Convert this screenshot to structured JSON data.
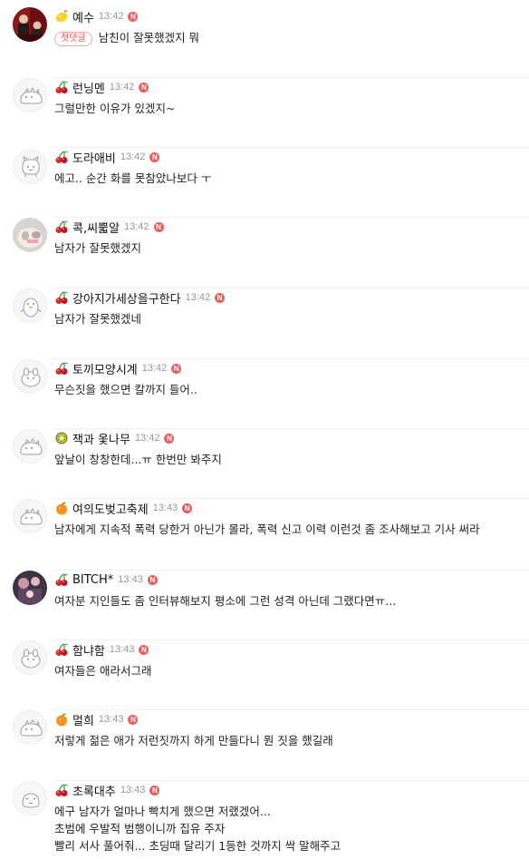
{
  "comments": [
    {
      "nick": "예수",
      "time": "13:42",
      "badge": "N",
      "emoji": "lemon-icon",
      "avatar": "photo",
      "first_badge": "첫댓글",
      "lines": [
        "남친이 잘못했겠지 뭐"
      ]
    },
    {
      "nick": "런닝멘",
      "time": "13:42",
      "badge": "N",
      "emoji": "cherry-icon",
      "avatar": "default",
      "lines": [
        "그럴만한 이유가 있겠지~"
      ]
    },
    {
      "nick": "도라애비",
      "time": "13:42",
      "badge": "N",
      "emoji": "cherry-icon",
      "avatar": "default",
      "lines": [
        "에고.. 순간 화를 못참았나보다 ㅜ"
      ]
    },
    {
      "nick": "콕,씨뿗알",
      "time": "13:42",
      "badge": "N",
      "emoji": "cherry-icon",
      "avatar": "photo",
      "lines": [
        "남자가 잘못했겠지"
      ]
    },
    {
      "nick": "강아지가세상을구한다",
      "time": "13:42",
      "badge": "N",
      "emoji": "cherry-icon",
      "avatar": "default",
      "lines": [
        "남자가 잘못했겠네"
      ]
    },
    {
      "nick": "토끼모양시계",
      "time": "13:42",
      "badge": "N",
      "emoji": "cherry-icon",
      "avatar": "default",
      "lines": [
        "무슨짓을 했으면 칼까지 들어.."
      ]
    },
    {
      "nick": "잭과 옻나무",
      "time": "13:42",
      "badge": "N",
      "emoji": "kiwi-icon",
      "avatar": "default",
      "lines": [
        "앞날이 창창한데...ㅠ 한번만 봐주지"
      ]
    },
    {
      "nick": "여의도벚고축제",
      "time": "13:43",
      "badge": "N",
      "emoji": "orange-icon",
      "avatar": "default",
      "lines": [
        "남자에게 지속적 폭력 당한거 아닌가 몰라, 폭력 신고 이력 이런것 좀 조사해보고 기사 써라"
      ]
    },
    {
      "nick": "BITCH*",
      "time": "13:43",
      "badge": "N",
      "emoji": "cherry-icon",
      "avatar": "photo",
      "lines": [
        "여자분 지인들도 좀 인터뷰해보지 평소에 그런 성격 아닌데 그랬다면ㅠ..."
      ]
    },
    {
      "nick": "함냐함",
      "time": "13:43",
      "badge": "N",
      "emoji": "cherry-icon",
      "avatar": "default",
      "lines": [
        "여자들은 애라서그래"
      ]
    },
    {
      "nick": "멀희",
      "time": "13:43",
      "badge": "N",
      "emoji": "orange-icon",
      "avatar": "default",
      "lines": [
        "저렇게 젊은 애가 저런짓까지 하게 만들다니 뭔 짓을 했길래"
      ]
    },
    {
      "nick": "초록대추",
      "time": "13:43",
      "badge": "N",
      "emoji": "cherry-icon",
      "avatar": "default",
      "lines": [
        "에구 남자가 얼마나 빡치게 했으면 저랬겠어...",
        "초범에 우발적 범행이니까 집유 주자",
        "빨리 서사 풀어줘... 초딩때 달리기 1등한 것까지 싹 말해주고"
      ]
    }
  ]
}
